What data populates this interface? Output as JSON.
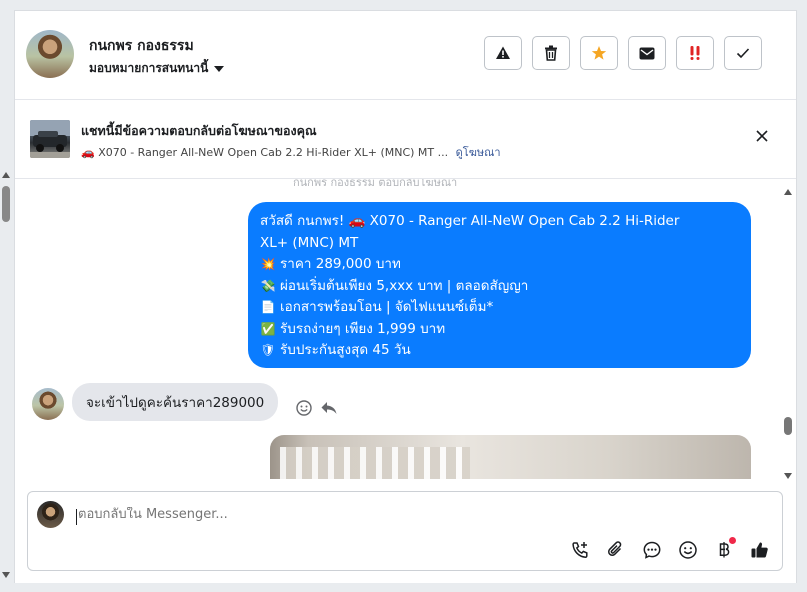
{
  "header": {
    "name": "กนกพร กองธรรม",
    "assign_label": "มอบหมายการสนทนานี้",
    "tools": [
      {
        "name": "report-button",
        "icon": "warning-icon"
      },
      {
        "name": "delete-button",
        "icon": "trash-icon"
      },
      {
        "name": "star-button",
        "icon": "star-icon",
        "color": "#f5a623"
      },
      {
        "name": "mark-unread-button",
        "icon": "envelope-icon"
      },
      {
        "name": "important-button",
        "icon": "double-exclamation-icon",
        "color": "#e02424"
      },
      {
        "name": "done-button",
        "icon": "check-icon"
      }
    ]
  },
  "ad_bar": {
    "title": "แชทนี้มีข้อความตอบกลับต่อโฆษณาของคุณ",
    "subtitle": "🚗 X070 - Ranger All-NeW Open Cab 2.2 Hi-Rider XL+ (MNC) MT ...",
    "link": "ดูโฆษณา"
  },
  "chat": {
    "faded_note": "กนกพร กองธรรม ตอบกลับโฆษณา",
    "outgoing": {
      "lines": [
        {
          "emoji": "",
          "text": "สวัสดี กนกพร! 🚗 X070 - Ranger All-NeW Open Cab 2.2 Hi-Rider"
        },
        {
          "emoji": "",
          "text": "XL+ (MNC) MT"
        },
        {
          "emoji": "💥",
          "text": "ราคา 289,000 บาท"
        },
        {
          "emoji": "💸",
          "text": "ผ่อนเริ่มต้นเพียง 5,xxx บาท | ตลอดสัญญา"
        },
        {
          "emoji": "📄",
          "text": "เอกสารพร้อมโอน | จัดไฟแนนซ์เต็ม*"
        },
        {
          "emoji": "✅",
          "text": "รับรถง่ายๆ เพียง 1,999 บาท"
        },
        {
          "emoji": "🛡",
          "text": "รับประกันสูงสุด 45 วัน"
        }
      ]
    },
    "incoming": {
      "text": "จะเข้าไปดูคะค้นราคา289000"
    }
  },
  "composer": {
    "placeholder": "ตอบกลับใน Messenger...",
    "icons": [
      "call-plus-icon",
      "attachment-icon",
      "saved-replies-icon",
      "emoji-icon",
      "baht-payment-icon",
      "thumbs-up-icon"
    ]
  },
  "colors": {
    "accent": "#0a7cff",
    "star": "#f5a623",
    "important": "#e02424",
    "notification_dot": "#f02849",
    "link": "#385898"
  }
}
